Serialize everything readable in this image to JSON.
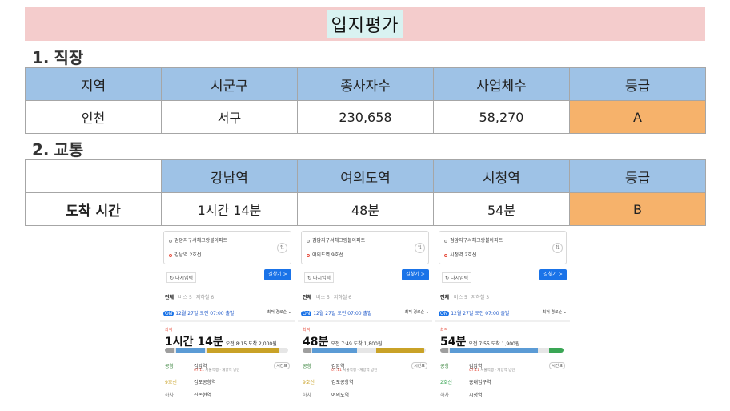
{
  "title": "입지평가",
  "section1": {
    "num": "1.",
    "label": "직장"
  },
  "table1": {
    "headers": [
      "지역",
      "시군구",
      "종사자수",
      "사업체수",
      "등급"
    ],
    "row": [
      "인천",
      "서구",
      "230,658",
      "58,270",
      "A"
    ]
  },
  "section2": {
    "num": "2.",
    "label": "교통"
  },
  "table2": {
    "headers": [
      "",
      "강남역",
      "여의도역",
      "시청역",
      "등급"
    ],
    "row": [
      "도착 시간",
      "1시간 14분",
      "48분",
      "54분",
      "B"
    ]
  },
  "colors": {
    "title_bg": "#f4cccc",
    "title_highlight": "#d9f2f1",
    "header_bg": "#9ec2e6",
    "grade_bg": "#f6b26b"
  },
  "shots": [
    {
      "origin": "검암지구서해그랑블아파트",
      "dest": "강남역 2호선",
      "reset": "다시입력",
      "find": "길찾기 >",
      "tabs": [
        "전체",
        "버스 5",
        "지하철 6"
      ],
      "date": "12월 27일 오전 07:00 출발",
      "on": "ON",
      "sort": "최적 경로순 ⌄",
      "best": "최적",
      "duration": "1시간 14분",
      "detail": "오전 8:15 도착  2,000원",
      "steps": [
        {
          "lbl": "공항",
          "name": "검암역",
          "sub_red": "07:11",
          "sub": " 서울역행 · 계양역 방면"
        },
        {
          "lbl": "9호선",
          "name": "김포공항역",
          "sub_red": "",
          "sub": ""
        },
        {
          "lbl": "하차",
          "name": "신논현역",
          "sub_red": "",
          "sub": ""
        }
      ],
      "timetag": "시간표"
    },
    {
      "origin": "검암지구서해그랑블아파트",
      "dest": "여의도역 9호선",
      "reset": "다시입력",
      "find": "길찾기 >",
      "tabs": [
        "전체",
        "버스 5",
        "지하철 6"
      ],
      "date": "12월 27일 오전 07:00 출발",
      "on": "ON",
      "sort": "최적 경로순 ⌄",
      "best": "최적",
      "duration": "48분",
      "detail": "오전 7:49 도착  1,800원",
      "steps": [
        {
          "lbl": "공항",
          "name": "검암역",
          "sub_red": "07:11",
          "sub": " 서울역행 · 계양역 방면"
        },
        {
          "lbl": "9호선",
          "name": "김포공항역",
          "sub_red": "",
          "sub": ""
        },
        {
          "lbl": "하차",
          "name": "여의도역",
          "sub_red": "",
          "sub": ""
        }
      ],
      "timetag": "시간표"
    },
    {
      "origin": "검암지구서해그랑블아파트",
      "dest": "시청역 2호선",
      "reset": "다시입력",
      "find": "길찾기 >",
      "tabs": [
        "전체",
        "버스 5",
        "지하철 3"
      ],
      "date": "12월 27일 오전 07:00 출발",
      "on": "ON",
      "sort": "최적 경로순 ⌄",
      "best": "최적",
      "duration": "54분",
      "detail": "오전 7:55 도착  1,900원",
      "steps": [
        {
          "lbl": "공항",
          "name": "검암역",
          "sub_red": "07:11",
          "sub": " 서울역행 · 계양역 방면"
        },
        {
          "lbl": "2호선",
          "name": "홍대입구역",
          "sub_red": "",
          "sub": ""
        },
        {
          "lbl": "하차",
          "name": "시청역",
          "sub_red": "",
          "sub": ""
        }
      ],
      "timetag": "시간표"
    }
  ]
}
